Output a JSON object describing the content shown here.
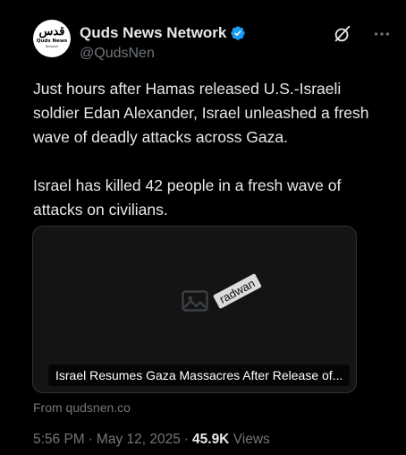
{
  "account": {
    "display_name": "Quds News Network",
    "handle": "@QudsNen",
    "verified": true,
    "avatar": {
      "logo_main": "قدس",
      "logo_sub": "Quds News",
      "logo_tiny": "Network"
    }
  },
  "actions": {
    "grok_icon": "grok-icon",
    "more_icon": "more-icon"
  },
  "tweet": {
    "text": "Just hours after Hamas released U.S.-Israeli soldier Edan Alexander, Israel unleashed a fresh wave of deadly attacks across Gaza.\n\nIsrael has killed 42 people in a fresh wave of attacks on civilians."
  },
  "card": {
    "caption": "Israel Resumes Gaza Massacres After Release of...",
    "watermark": "radwan",
    "source": "From qudsnen.co"
  },
  "meta": {
    "time": "5:56 PM",
    "date": "May 12, 2025",
    "views_count": "45.9K",
    "views_label": "Views",
    "separator": "·"
  },
  "colors": {
    "background": "#000000",
    "text_primary": "#e7e9ea",
    "text_secondary": "#71767b",
    "verified_blue": "#1d9bf0"
  }
}
